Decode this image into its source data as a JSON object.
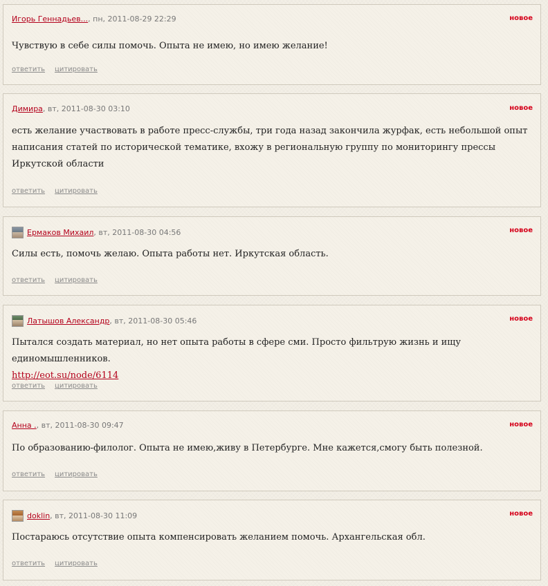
{
  "comments": [
    {
      "author": "Игорь Геннадьев...",
      "date": ", пн, 2011-08-29 22:29",
      "badge": "новое",
      "text": "Чувствую в себе силы помочь. Опыта не имею, но имею желание!",
      "link": "",
      "reply": "ответить",
      "quote": "цитировать",
      "avatar": "",
      "avatar_icon": ""
    },
    {
      "author": "Димира",
      "date": ", вт, 2011-08-30 03:10",
      "badge": "новое",
      "text": "есть желание участвовать в работе пресс-службы, три года назад закончила журфак, есть небольшой опыт написания статей по исторической тематике, вхожу в региональную группу по мониторингу прессы Иркутской области",
      "link": "",
      "reply": "ответить",
      "quote": "цитировать",
      "avatar": "",
      "avatar_icon": ""
    },
    {
      "author": "Ермаков Михаил",
      "date": ", вт, 2011-08-30 04:56",
      "badge": "новое",
      "text": "Силы есть, помочь желаю. Опыта работы нет. Иркутская область.",
      "link": "",
      "reply": "ответить",
      "quote": "цитировать",
      "avatar": "ermakov",
      "avatar_icon": "user-avatar-photo"
    },
    {
      "author": "Латышов Александр",
      "date": ", вт, 2011-08-30 05:46",
      "badge": "новое",
      "text": "Пытался создать материал, но нет опыта работы в сфере сми. Просто фильтрую жизнь и ищу единомышленников.",
      "link": "http://eot.su/node/6114",
      "reply": "ответить",
      "quote": "цитировать",
      "avatar": "latyshov",
      "avatar_icon": "user-avatar-photo"
    },
    {
      "author": "Анна .",
      "date": ", вт, 2011-08-30 09:47",
      "badge": "новое",
      "text": "По образованию-филолог. Опыта не имею,живу в Петербурге. Мне кажется,смогу быть полезной.",
      "link": "",
      "reply": "ответить",
      "quote": "цитировать",
      "avatar": "",
      "avatar_icon": ""
    },
    {
      "author": "doklin",
      "date": ", вт, 2011-08-30 11:09",
      "badge": "новое",
      "text": "Постараюсь отсутствие опыта компенсировать желанием помочь. Архангельская обл.",
      "link": "",
      "reply": "ответить",
      "quote": "цитировать",
      "avatar": "doklin",
      "avatar_icon": "user-avatar-photo"
    }
  ],
  "colors": {
    "author_link": "#b3001b",
    "new_badge": "#d5001a",
    "meta_text": "#777777"
  }
}
